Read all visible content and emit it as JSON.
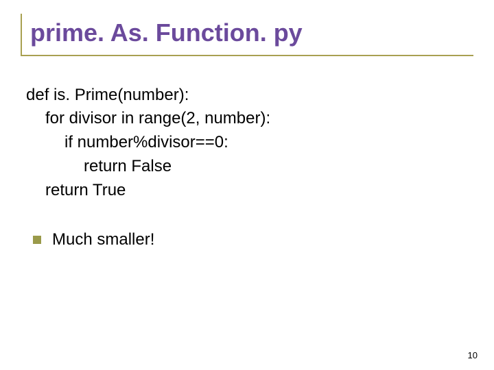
{
  "title": "prime. As. Function. py",
  "code": {
    "line1": "def is. Prime(number):",
    "line2": "for divisor in range(2, number):",
    "line3": "if number%divisor==0:",
    "line4": "return False",
    "line5": "return True"
  },
  "bullet": {
    "text": "Much smaller!"
  },
  "page_number": "10"
}
